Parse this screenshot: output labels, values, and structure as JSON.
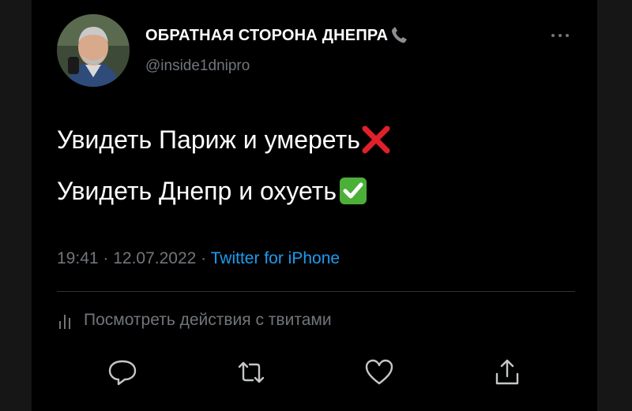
{
  "tweet": {
    "author_name": "ОБРАТНАЯ СТОРОНА ДНЕПРА",
    "author_handle": "@inside1dnipro",
    "lines": [
      {
        "text": "Увидеть Париж и умереть",
        "emoji": "cross-mark"
      },
      {
        "text": "Увидеть Днепр и охуеть",
        "emoji": "check-mark-button"
      }
    ],
    "time": "19:41",
    "date": "12.07.2022",
    "source": "Twitter for iPhone",
    "separator": " · "
  },
  "activity_link": "Посмотреть действия с твитами",
  "actions": [
    "reply-icon",
    "retweet-icon",
    "like-icon",
    "share-icon"
  ],
  "colors": {
    "background": "#000000",
    "text": "#ffffff",
    "muted": "#71767b",
    "link": "#1d9bf0",
    "cross": "#e0202a",
    "check": "#4caf38"
  }
}
